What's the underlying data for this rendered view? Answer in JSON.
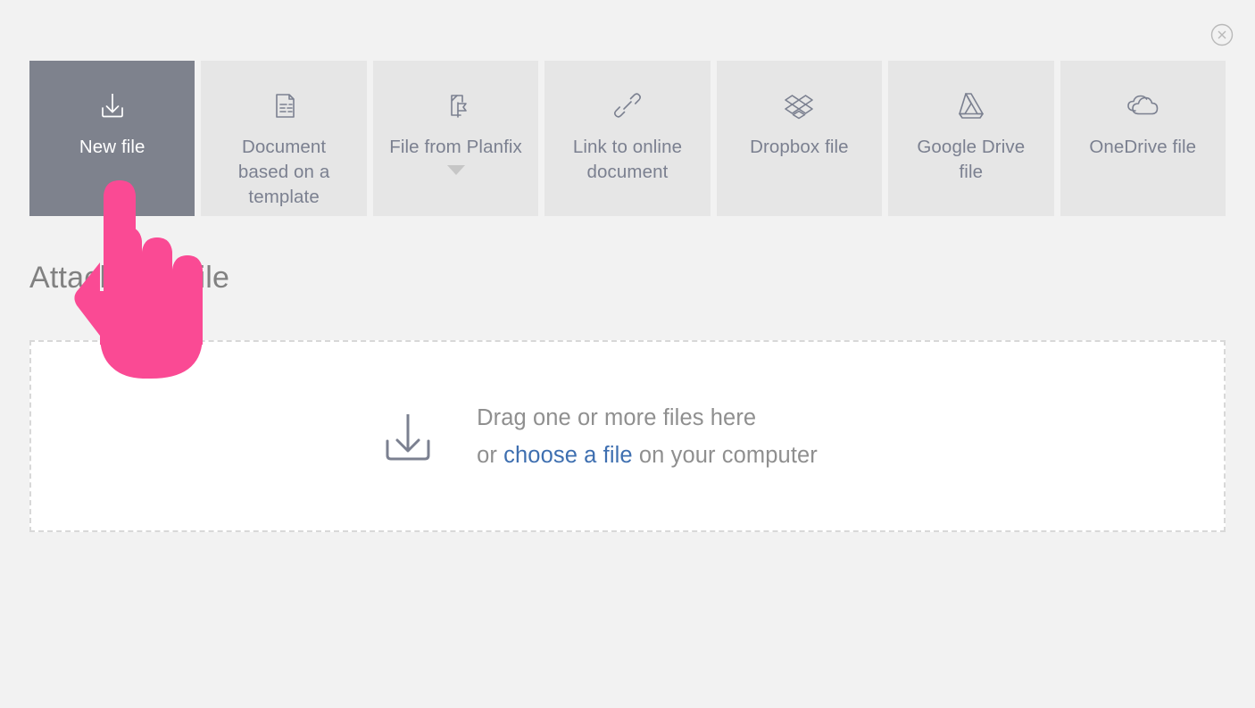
{
  "dialog": {
    "title": "Attach new file",
    "close_icon": "close-circle-icon"
  },
  "colors": {
    "page_background": "#f2f2f2",
    "tab_background": "#e6e6e6",
    "tab_selected_background": "#7e828d",
    "tab_label": "#7b8090",
    "tab_selected_label": "#ffffff",
    "title": "#818181",
    "dropzone_background": "#ffffff",
    "dropzone_border": "#d8d8d8",
    "dropzone_text": "#8f8f8f",
    "link": "#3e6fb0",
    "cursor_pink": "#fa4a94",
    "caret": "#c6c6c6"
  },
  "tabs": [
    {
      "label": "New file",
      "icon": "download-tray-icon",
      "selected": true,
      "has_dropdown": false
    },
    {
      "label": "Document based on a template",
      "icon": "document-lines-icon",
      "selected": false,
      "has_dropdown": false
    },
    {
      "label": "File from Planfix",
      "icon": "file-flag-icon",
      "selected": false,
      "has_dropdown": true
    },
    {
      "label": "Link to online document",
      "icon": "chain-link-icon",
      "selected": false,
      "has_dropdown": false
    },
    {
      "label": "Dropbox file",
      "icon": "dropbox-icon",
      "selected": false,
      "has_dropdown": false
    },
    {
      "label": "Google Drive file",
      "icon": "google-drive-icon",
      "selected": false,
      "has_dropdown": false
    },
    {
      "label": "OneDrive file",
      "icon": "onedrive-cloud-icon",
      "selected": false,
      "has_dropdown": false
    }
  ],
  "dropzone": {
    "icon": "download-tray-icon",
    "line1": "Drag one or more files here",
    "line2_prefix": "or ",
    "line2_link": "choose a file",
    "line2_suffix": " on your computer"
  },
  "cursor": {
    "icon": "pointing-hand-cursor"
  }
}
